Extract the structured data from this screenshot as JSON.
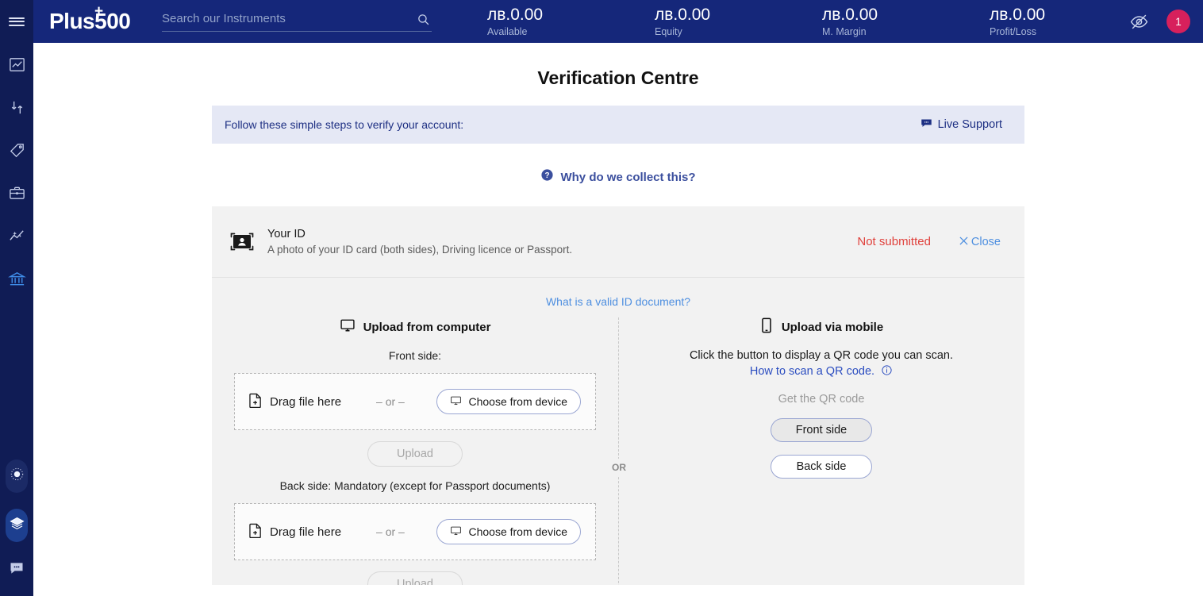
{
  "brand": {
    "name": "Plus500",
    "name_main": "Plus",
    "name_num": "500",
    "plus_glyph": "+"
  },
  "colors": {
    "topbar_bg": "#15277a",
    "rail_bg": "#101c55",
    "accent_link": "#4e8fe0",
    "dark_link": "#1d2f83",
    "status_error": "#e0413c",
    "badge": "#d7205c",
    "panel_bg": "#f2f2f2",
    "notice_bg": "#e5e8f5"
  },
  "search": {
    "placeholder": "Search our Instruments",
    "value": "",
    "icon": "search-icon"
  },
  "stats": [
    {
      "value": "лв.0.00",
      "label": "Available"
    },
    {
      "value": "лв.0.00",
      "label": "Equity"
    },
    {
      "value": "лв.0.00",
      "label": "M. Margin"
    },
    {
      "value": "лв.0.00",
      "label": "Profit/Loss"
    }
  ],
  "topbar_right": {
    "eye_icon": "eye-off-icon",
    "badge_count": "1"
  },
  "sidebar": {
    "menu_icon": "hamburger-menu-icon",
    "items": [
      {
        "icon": "line-chart-icon",
        "name": "sidebar-item-charts",
        "active": false
      },
      {
        "icon": "trade-arrows-icon",
        "name": "sidebar-item-trade",
        "active": false
      },
      {
        "icon": "price-tag-icon",
        "name": "sidebar-item-instruments",
        "active": false
      },
      {
        "icon": "briefcase-icon",
        "name": "sidebar-item-portfolio",
        "active": false
      },
      {
        "icon": "analytics-sparkle-icon",
        "name": "sidebar-item-insights",
        "active": false
      },
      {
        "icon": "bank-icon",
        "name": "sidebar-item-funds",
        "active": true
      }
    ],
    "bottom_items": [
      {
        "icon": "brightness-dial-icon",
        "name": "sidebar-theme-toggle"
      },
      {
        "icon": "layers-icon",
        "name": "sidebar-layers"
      },
      {
        "icon": "chat-bubble-icon",
        "name": "sidebar-chat"
      }
    ]
  },
  "page": {
    "title": "Verification Centre"
  },
  "notice": {
    "text": "Follow these simple steps to verify your account:",
    "support_label": "Live Support",
    "support_icon": "chat-bubble-icon"
  },
  "why": {
    "label": "Why do we collect this?",
    "icon": "question-circle-icon"
  },
  "id_section": {
    "icon": "id-card-icon",
    "title": "Your ID",
    "description": "A photo of your ID card (both sides), Driving licence or Passport.",
    "status": "Not submitted",
    "close_label": "Close",
    "close_icon": "close-x-icon"
  },
  "valid_doc_link": "What is a valid ID document?",
  "divider_label": "OR",
  "upload_computer": {
    "heading": "Upload from computer",
    "icon": "monitor-icon",
    "front_label": "Front side:",
    "back_label": "Back side: Mandatory (except for Passport documents)",
    "drag_label": "Drag file here",
    "drag_icon": "file-add-icon",
    "or_label": "– or –",
    "choose_label": "Choose from device",
    "choose_icon": "monitor-small-icon",
    "upload_label": "Upload",
    "upload_disabled": true
  },
  "upload_mobile": {
    "heading": "Upload via mobile",
    "icon": "mobile-phone-icon",
    "line1": "Click the button to display a QR code you can scan.",
    "link": "How to scan a QR code.",
    "info_icon": "info-circle-icon",
    "qr_label": "Get the QR code",
    "front_button": "Front side",
    "back_button": "Back side"
  }
}
